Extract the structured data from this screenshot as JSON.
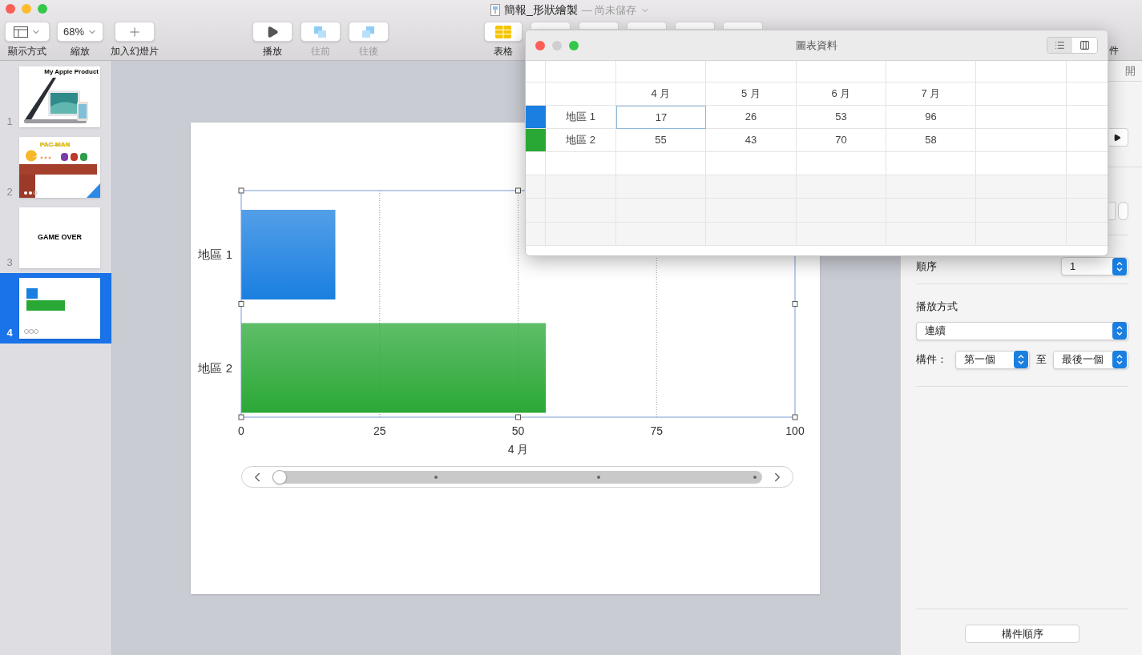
{
  "window": {
    "title": "簡報_形狀繪製",
    "subtitle": "— 尚未儲存"
  },
  "toolbar": {
    "items": [
      {
        "kind": "view",
        "label": "顯示方式",
        "disabled": false
      },
      {
        "kind": "zoom",
        "label": "縮放",
        "value": "68%",
        "disabled": false
      },
      {
        "kind": "add",
        "label": "加入幻燈片",
        "disabled": false
      },
      {
        "kind": "play",
        "label": "播放",
        "disabled": false
      },
      {
        "kind": "forward",
        "label": "往前",
        "disabled": true
      },
      {
        "kind": "backward",
        "label": "往後",
        "disabled": true
      },
      {
        "kind": "table",
        "label": "表格",
        "disabled": false
      }
    ],
    "cut_label": "件"
  },
  "slides": [
    {
      "number": "1",
      "kind": "product",
      "title": "My Apple Product",
      "selected": false
    },
    {
      "number": "2",
      "kind": "game",
      "title": "PAC-MAN",
      "selected": false
    },
    {
      "number": "3",
      "kind": "text",
      "title": "GAME OVER",
      "selected": false
    },
    {
      "number": "4",
      "kind": "chart",
      "selected": true
    }
  ],
  "chart": {
    "chart_data": {
      "type": "bar",
      "orientation": "horizontal",
      "categories": [
        "地區 1",
        "地區 2"
      ],
      "series": [
        {
          "name": "4 月",
          "values": [
            17,
            55
          ]
        }
      ],
      "grid": true,
      "xlim": [
        0,
        100
      ],
      "xticks": [
        0,
        25,
        50,
        75,
        100
      ]
    },
    "slider": {
      "level": 0
    }
  },
  "chart_data_window": {
    "title": "圖表資料",
    "view_toggle": [
      {
        "kind": "rows",
        "selected": false
      },
      {
        "kind": "columns",
        "selected": true
      }
    ],
    "columns": [
      "4 月",
      "5 月",
      "6 月",
      "7 月"
    ],
    "rows": [
      {
        "label": "地區 1",
        "color": "#1a7fe0",
        "cells": [
          {
            "value": "17",
            "selected": true
          },
          {
            "value": "26",
            "selected": false
          },
          {
            "value": "53",
            "selected": false
          },
          {
            "value": "96",
            "selected": false
          }
        ]
      },
      {
        "label": "地區 2",
        "color": "#2aa836",
        "cells": [
          {
            "value": "55",
            "selected": false
          },
          {
            "value": "43",
            "selected": false
          },
          {
            "value": "70",
            "selected": false
          },
          {
            "value": "58",
            "selected": false
          }
        ]
      }
    ]
  },
  "inspector": {
    "cut_tab": "開",
    "order": {
      "label": "順序",
      "value": "1"
    },
    "delivery": {
      "label": "播放方式",
      "value": "連續"
    },
    "build": {
      "label": "構件：",
      "from": "第一個",
      "to_label": "至",
      "to": "最後一個"
    },
    "order_button": "構件順序"
  }
}
